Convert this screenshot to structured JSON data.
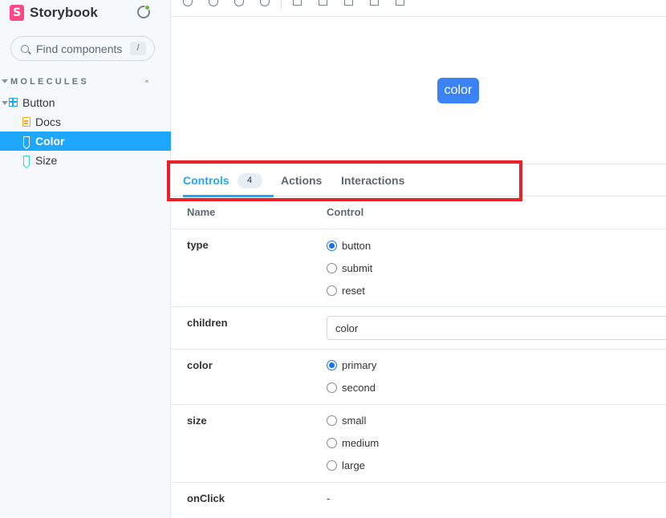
{
  "sidebar": {
    "brand": "Storybook",
    "brand_logo_letter": "S",
    "search_placeholder": "Find components",
    "search_shortcut": "/",
    "group_label": "MOLECULES",
    "component": "Button",
    "items": [
      {
        "label": "Docs",
        "type": "docs"
      },
      {
        "label": "Color",
        "type": "story",
        "selected": true
      },
      {
        "label": "Size",
        "type": "story"
      }
    ]
  },
  "preview": {
    "button_label": "color",
    "button_color": "#3b82f6"
  },
  "panel": {
    "tabs": [
      {
        "label": "Controls",
        "badge": "4",
        "active": true
      },
      {
        "label": "Actions"
      },
      {
        "label": "Interactions"
      }
    ],
    "table_headers": {
      "name": "Name",
      "control": "Control"
    },
    "rows": {
      "type": {
        "name": "type",
        "options": [
          "button",
          "submit",
          "reset"
        ],
        "selected": "button"
      },
      "children": {
        "name": "children",
        "value": "color"
      },
      "color": {
        "name": "color",
        "options": [
          "primary",
          "second"
        ],
        "selected": "primary"
      },
      "size": {
        "name": "size",
        "options": [
          "small",
          "medium",
          "large"
        ],
        "selected": null
      },
      "onClick": {
        "name": "onClick",
        "value": "-"
      }
    }
  },
  "colors": {
    "accent": "#1ea7fd",
    "highlight": "#e8212b"
  }
}
